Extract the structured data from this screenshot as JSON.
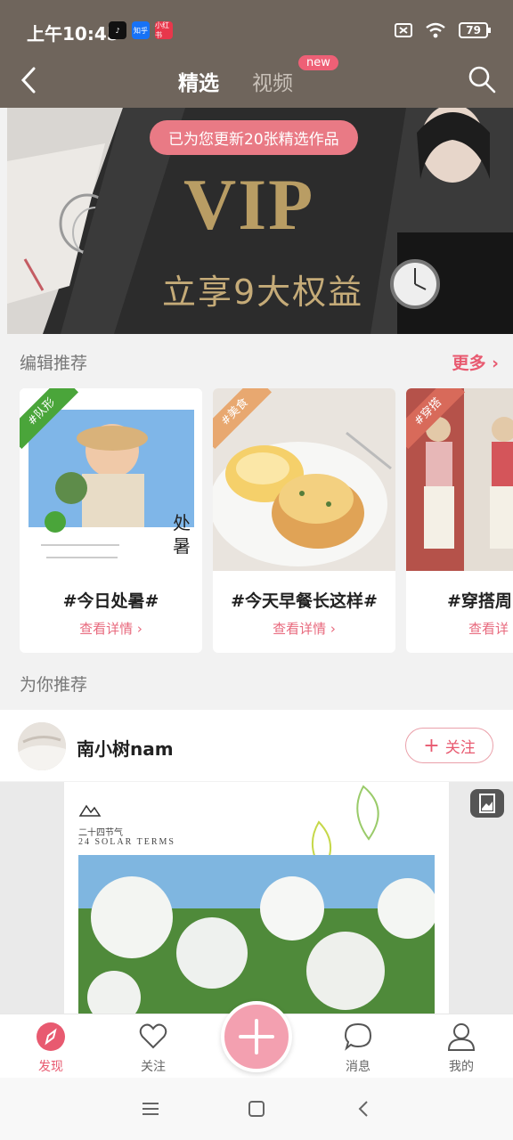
{
  "status_bar": {
    "time": "上午10:45",
    "app_icons": [
      "tiktok-icon",
      "zhihu-icon",
      "xiaohongshu-icon"
    ],
    "app_icon_labels": [
      "知乎",
      "小红书"
    ],
    "battery": "79"
  },
  "header": {
    "tab_selected": "精选",
    "tab_video": "视频",
    "new_badge": "new"
  },
  "banner": {
    "message": "已为您更新20张精选作品",
    "vip": "VIP",
    "slogan": "立享9大权益"
  },
  "editor_picks": {
    "title": "编辑推荐",
    "more": "更多",
    "cards": [
      {
        "tag": "#队形",
        "title": "#今日处暑#",
        "link": "查看详情",
        "tag_color": "#4aa53a"
      },
      {
        "tag": "#美食",
        "title": "#今天早餐长这样#",
        "link": "查看详情",
        "tag_color": "#e8a870"
      },
      {
        "tag": "#穿搭",
        "title": "#穿搭周",
        "link": "查看详",
        "tag_color": "#d86a5a"
      }
    ]
  },
  "for_you": {
    "title": "为你推荐",
    "user": "南小树nam",
    "follow": "关注",
    "solar_cn": "二十四节气",
    "solar_en": "24 SOLAR TERMS"
  },
  "bottom_nav": {
    "items": [
      {
        "label": "发现",
        "icon": "discover-icon"
      },
      {
        "label": "关注",
        "icon": "heart-icon"
      },
      {
        "label": "消息",
        "icon": "message-icon"
      },
      {
        "label": "我的",
        "icon": "profile-icon"
      }
    ]
  },
  "colors": {
    "header_bg": "#6f655c",
    "accent": "#e85a70"
  }
}
